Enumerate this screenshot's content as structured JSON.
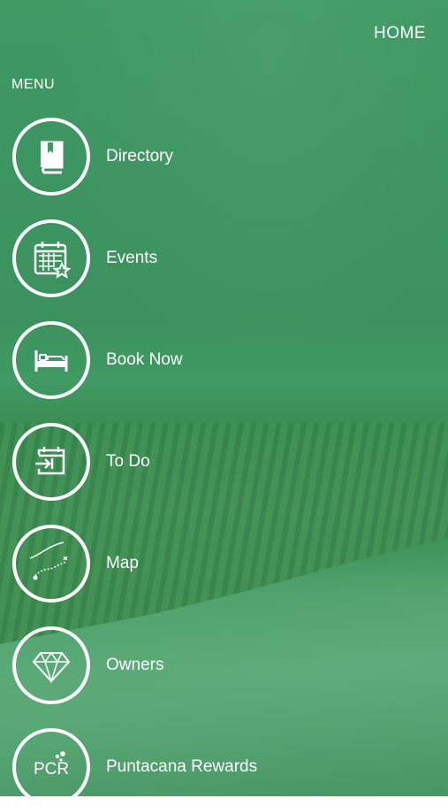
{
  "header": {
    "home_label": "HOME"
  },
  "menu": {
    "title": "MENU",
    "items": [
      {
        "label": "Directory",
        "icon": "book-icon"
      },
      {
        "label": "Events",
        "icon": "calendar-star-icon"
      },
      {
        "label": "Book Now",
        "icon": "bed-icon"
      },
      {
        "label": "To Do",
        "icon": "calendar-enter-icon"
      },
      {
        "label": "Map",
        "icon": "treasure-map-icon"
      },
      {
        "label": "Owners",
        "icon": "diamond-icon"
      },
      {
        "label": "Puntacana Rewards",
        "icon": "pcr-logo-icon",
        "icon_text": "PCR"
      }
    ]
  },
  "colors": {
    "overlay_green": "#3f9a64",
    "foreground": "#ffffff"
  }
}
